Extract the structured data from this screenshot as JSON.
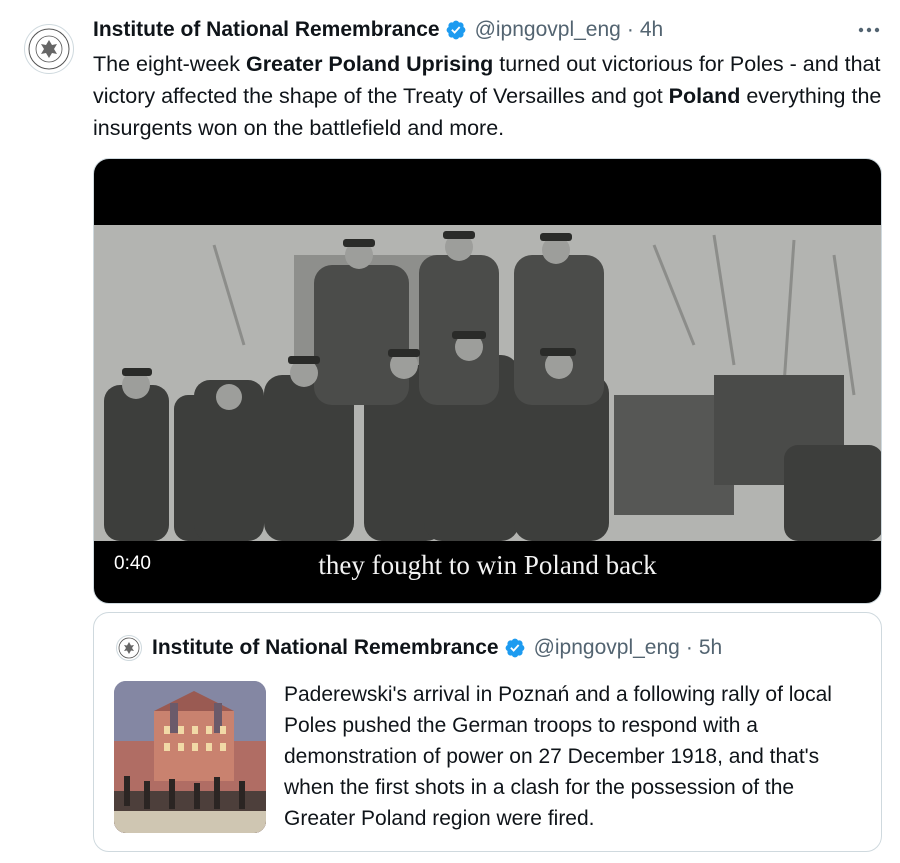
{
  "tweet": {
    "author_name": "Institute of National Remembrance",
    "handle": "@ipngovpl_eng",
    "time": "4h",
    "text_parts": {
      "p1": "The eight-week ",
      "b1": "Greater Poland Uprising",
      "p2": " turned out victorious for Poles - and that victory affected the shape of the Treaty of Versailles and got ",
      "b2": "Poland",
      "p3": " everything the insurgents won on the battlefield and more."
    }
  },
  "video": {
    "duration": "0:40",
    "caption": "they fought to win Poland back"
  },
  "quoted": {
    "author_name": "Institute of National Remembrance",
    "handle": "@ipngovpl_eng",
    "time": "5h",
    "text": "Paderewski's arrival in Poznań and a following rally of local Poles pushed the German troops to respond with a demonstration of power on 27 December 1918, and that's when the first shots in a clash for the possession of the Greater Poland region were fired."
  },
  "icons": {
    "verified": "verified-badge-icon",
    "more": "more-options-icon",
    "avatar": "institute-seal-logo"
  },
  "colors": {
    "verified_blue": "#1d9bf0",
    "secondary_text": "#536471",
    "border": "#cfd9de"
  }
}
